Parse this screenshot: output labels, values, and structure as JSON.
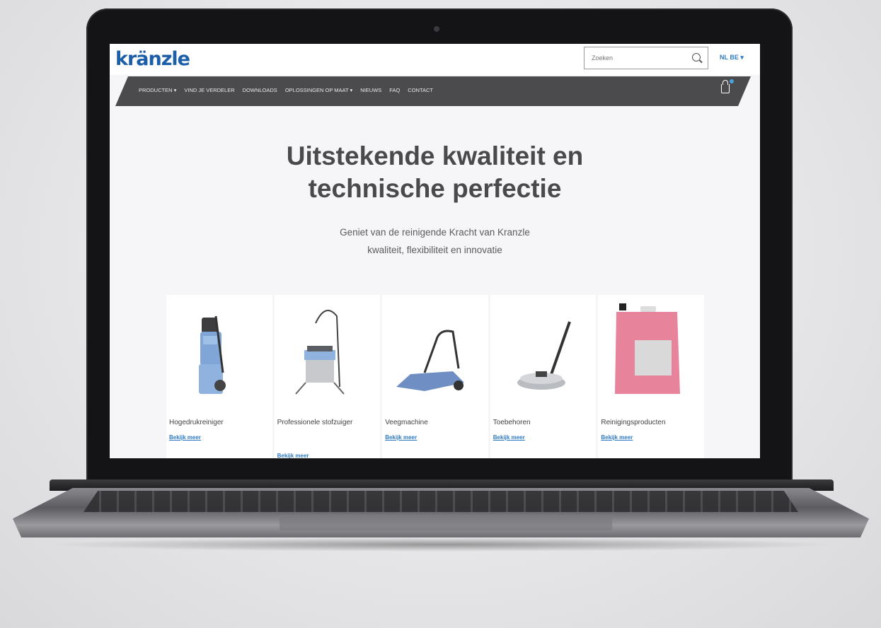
{
  "site": {
    "logo_text": "kränzle",
    "search": {
      "placeholder": "Zoeken"
    },
    "language": "NL BE ▾",
    "nav": [
      "PRODUCTEN ▾",
      "VIND JE VERDELER",
      "DOWNLOADS",
      "OPLOSSINGEN OP MAAT ▾",
      "NIEUWS",
      "FAQ",
      "CONTACT"
    ]
  },
  "hero": {
    "title_line1": "Uitstekende kwaliteit en",
    "title_line2": "technische perfectie",
    "subtitle_line1": "Geniet van de reinigende Kracht van Kranzle",
    "subtitle_line2": "kwaliteit, flexibiliteit en innovatie"
  },
  "products": [
    {
      "title": "Hogedrukreiniger",
      "link": "Bekijk meer",
      "icon": "pressure-washer"
    },
    {
      "title": "Professionele stofzuiger",
      "link": "Bekijk meer",
      "icon": "vacuum-cleaner"
    },
    {
      "title": "Veegmachine",
      "link": "Bekijk meer",
      "icon": "sweeper"
    },
    {
      "title": "Toebehoren",
      "link": "Bekijk meer",
      "icon": "surface-cleaner"
    },
    {
      "title": "Reinigingsproducten",
      "link": "Bekijk meer",
      "icon": "detergent-canister"
    }
  ],
  "colors": {
    "brand": "#1b5fa8",
    "nav_bg": "#4b4b4d",
    "link": "#2e7bc4"
  }
}
